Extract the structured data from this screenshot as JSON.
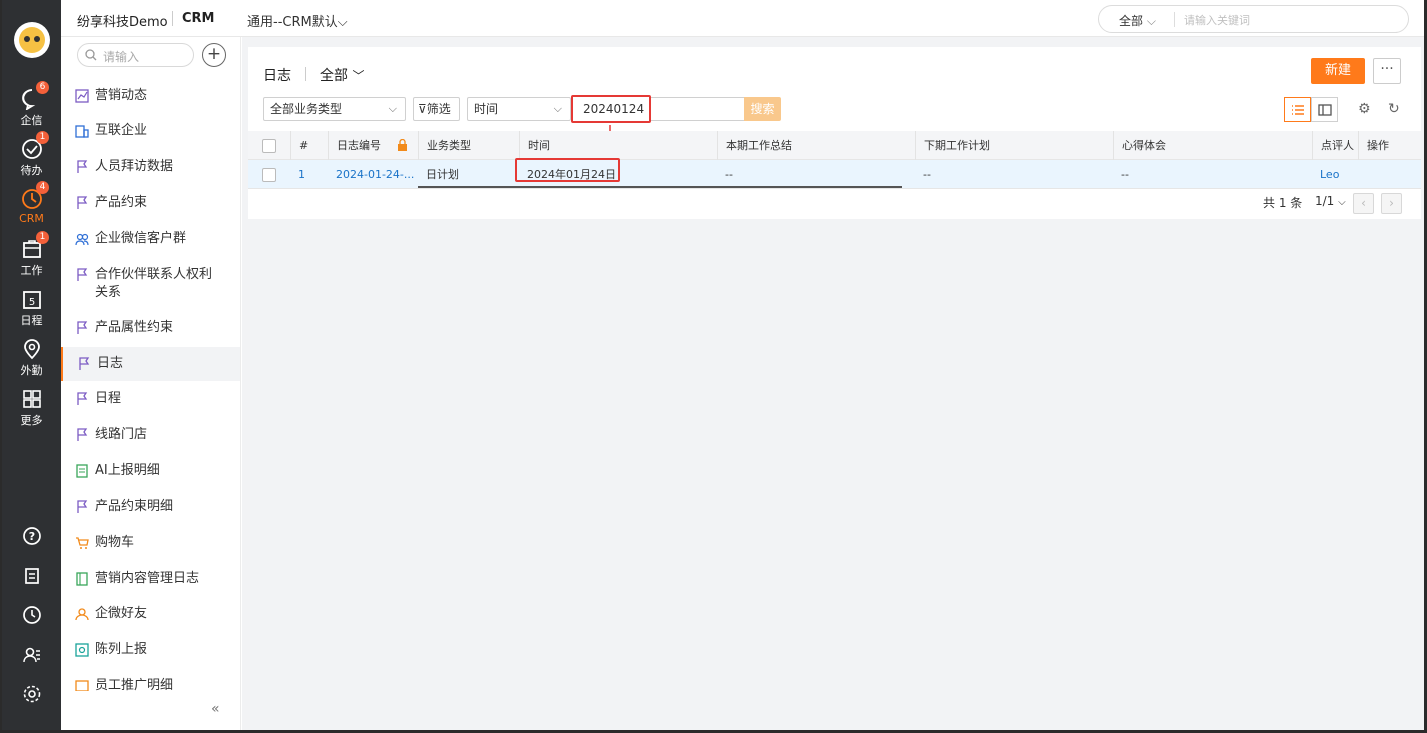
{
  "topbar": {
    "company": "纷享科技Demo",
    "app": "CRM",
    "scope": "通用--CRM默认",
    "search_scope": "全部",
    "search_placeholder": "请输入关键词"
  },
  "rail": {
    "items": [
      {
        "label": "企信",
        "badge": "6",
        "icon": "chat-icon"
      },
      {
        "label": "待办",
        "badge": "1",
        "icon": "check-circle-icon"
      },
      {
        "label": "CRM",
        "badge": "4",
        "icon": "crm-icon"
      },
      {
        "label": "工作",
        "badge": "1",
        "icon": "briefcase-icon"
      },
      {
        "label": "日程",
        "badge": "",
        "icon": "calendar-icon"
      },
      {
        "label": "外勤",
        "badge": "",
        "icon": "location-icon"
      },
      {
        "label": "更多",
        "badge": "",
        "icon": "grid-icon"
      }
    ],
    "bottom_icons": [
      "help-icon",
      "notes-icon",
      "clock-icon",
      "contacts-icon",
      "settings-icon"
    ]
  },
  "sidebar": {
    "search_placeholder": "请输入",
    "items": [
      "营销动态",
      "互联企业",
      "人员拜访数据",
      "产品约束",
      "企业微信客户群",
      "合作伙伴联系人权利关系",
      "产品属性约束",
      "日志",
      "日程",
      "线路门店",
      "AI上报明细",
      "产品约束明细",
      "购物车",
      "营销内容管理日志",
      "企微好友",
      "陈列上报",
      "员工推广明细"
    ],
    "active": "日志"
  },
  "panel": {
    "title": "日志",
    "scope": "全部",
    "new_button": "新建",
    "more_button": "···",
    "filters": {
      "type_select": "全部业务类型",
      "filter_button": "筛选",
      "field_select": "时间",
      "search_value": "20240124",
      "search_button": "搜索"
    }
  },
  "table": {
    "columns": [
      "#",
      "日志编号",
      "业务类型",
      "时间",
      "本期工作总结",
      "下期工作计划",
      "心得体会",
      "点评人",
      "操作"
    ],
    "rows": [
      {
        "index": "1",
        "number": "2024-01-24-...",
        "type": "日计划",
        "time": "2024年01月24日",
        "summary": "--",
        "plan": "--",
        "insight": "--",
        "reviewer": "Leo",
        "action": ""
      }
    ]
  },
  "pagination": {
    "total": "共 1 条",
    "page": "1/1"
  },
  "colors": {
    "accent": "#ff7a1a",
    "highlight": "#e53935",
    "link": "#1a73c8",
    "rail": "#2e3033"
  }
}
